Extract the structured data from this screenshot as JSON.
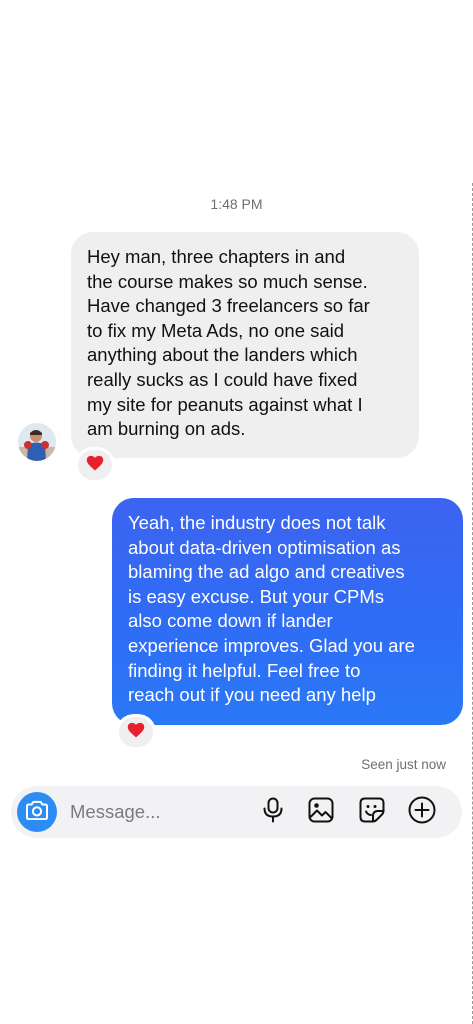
{
  "thread": {
    "timestamp": "1:48 PM",
    "incoming_message": {
      "lines": [
        "Hey man, three chapters in and",
        "the course makes so much sense.",
        "Have changed 3 freelancers so far",
        "to fix my Meta Ads, no one said",
        "anything about the landers which",
        "really sucks as I could have fixed",
        "my site for peanuts against what I",
        "am burning on ads."
      ],
      "reaction": "❤️"
    },
    "outgoing_message": {
      "lines": [
        "Yeah, the industry does not talk",
        "about data-driven optimisation as",
        "blaming the ad algo and creatives",
        "is easy excuse. But your CPMs",
        "also come down if lander",
        "experience improves. Glad you are",
        "finding it helpful. Feel free to",
        "reach out if you need any help"
      ],
      "reaction": "❤️"
    },
    "seen_status": "Seen just now"
  },
  "composer": {
    "placeholder": "Message...",
    "icons": [
      "camera-icon",
      "microphone-icon",
      "gallery-icon",
      "sticker-icon",
      "plus-circle-icon"
    ]
  },
  "colors": {
    "incoming_bubble": "#efeff0",
    "outgoing_bubble_top": "#3c64f0",
    "outgoing_bubble_bottom": "#2a78f6",
    "camera_button": "#2c8cf3",
    "heart": "#e8202e"
  }
}
